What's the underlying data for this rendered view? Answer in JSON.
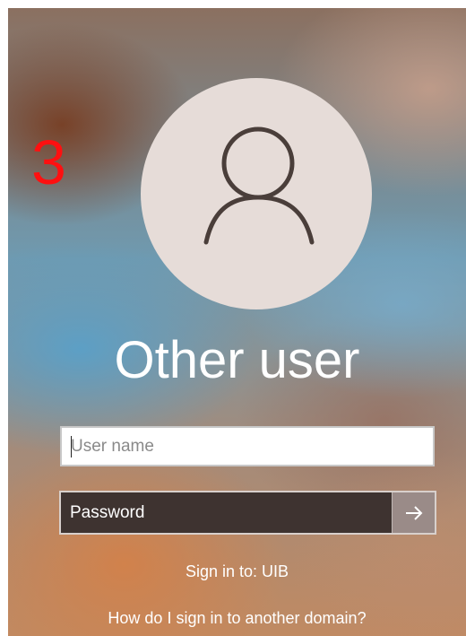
{
  "annotation": {
    "step_number": "3"
  },
  "login": {
    "user_title": "Other user",
    "avatar_icon": "user-silhouette-icon",
    "username_placeholder": "User name",
    "password_placeholder": "Password",
    "submit_icon": "arrow-right-icon",
    "sign_in_to": "Sign in to: UIB",
    "domain_help_link": "How do I sign in to another domain?"
  },
  "colors": {
    "annotation": "#ff1010",
    "text": "#ffffff",
    "password_box": "#3e3330",
    "avatar_bg": "#e6dcd8"
  }
}
